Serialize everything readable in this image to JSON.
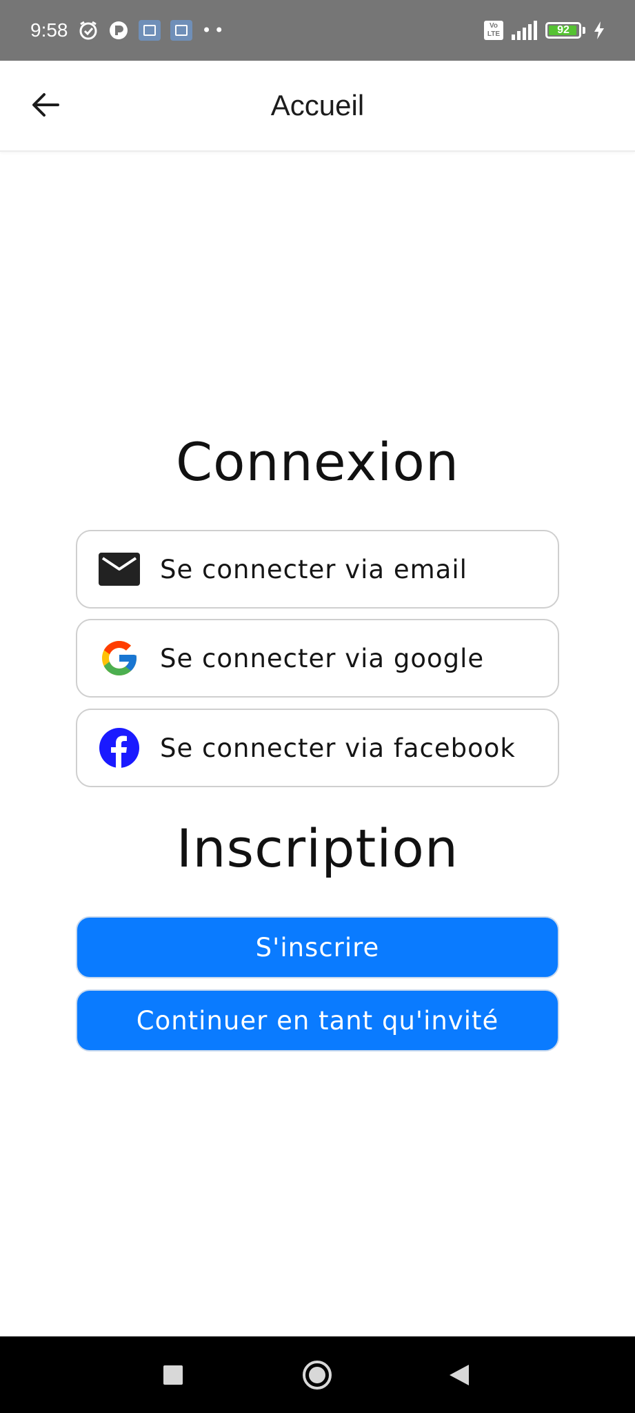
{
  "status_bar": {
    "time": "9:58",
    "battery_level": "92",
    "volte_top": "Vo",
    "volte_bottom": "LTE",
    "dots": "••"
  },
  "header": {
    "title": "Accueil",
    "back_icon": "arrow-left-icon"
  },
  "login": {
    "title": "Connexion",
    "options": [
      {
        "label": "Se connecter via email",
        "icon": "mail-icon"
      },
      {
        "label": "Se connecter via google",
        "icon": "google-icon"
      },
      {
        "label": "Se connecter via facebook",
        "icon": "facebook-icon"
      }
    ]
  },
  "signup": {
    "title": "Inscription",
    "register_label": "S'inscrire",
    "guest_label": "Continuer en tant qu'invité"
  },
  "colors": {
    "primary": "#0a7bff",
    "status_bar": "#767676",
    "battery": "#55c232",
    "facebook": "#1877f2"
  },
  "nav_bar": {
    "icons": [
      "square-icon",
      "circle-home-icon",
      "triangle-back-icon"
    ]
  }
}
